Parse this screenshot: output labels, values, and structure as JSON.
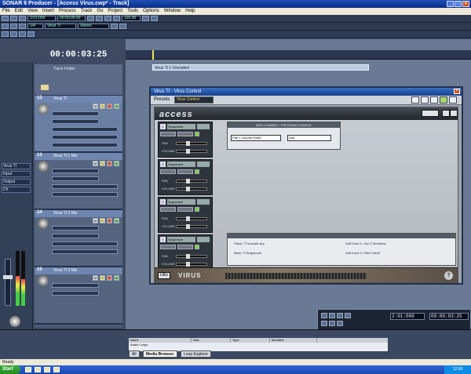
{
  "window": {
    "title": "SONAR 6 Producer - [Access Virus.cwp* - Track]",
    "controls": [
      "_",
      "□",
      "×"
    ]
  },
  "menu": [
    "File",
    "Edit",
    "View",
    "Insert",
    "Process",
    "Track",
    "Go",
    "Project",
    "Tools",
    "Options",
    "Window",
    "Help"
  ],
  "toolbar": {
    "time_field": "2:01:000",
    "bar_field": "00:00:00:00",
    "tempo_field": "120.00",
    "snap_field": "1/4",
    "midi_in": "Virus TI",
    "audio_in": "Stereo"
  },
  "transport": {
    "timecode": "00:00:03:25",
    "now_time": "2:01:000",
    "smpte": "00:00:03:25"
  },
  "inspector": {
    "rows": [
      "Virus TI",
      "Input",
      "Output",
      "Ch"
    ]
  },
  "tracks": {
    "folder_name": "Track Folder",
    "items": [
      {
        "num": "12",
        "name": "Virus TI"
      },
      {
        "num": "13",
        "name": "Virus TI 1 Mix"
      },
      {
        "num": "14",
        "name": "Virus TI 2 Mix"
      },
      {
        "num": "15",
        "name": "Virus TI 3 Mix"
      }
    ],
    "btn_m": "M",
    "btn_s": "S",
    "btn_r": "R",
    "btn_w": "W"
  },
  "arrange": {
    "clip_label": "Virus TI 1 (Vocoder)"
  },
  "plugin": {
    "title": "Virus TI - Virus Control",
    "preset_label": "Presets",
    "preset_value": "Virus Control"
  },
  "virus": {
    "logo": "access",
    "brand": "VIRUS",
    "bottom_button": "Utils",
    "help": "?",
    "parts": [
      {
        "num": "1",
        "name": "Sequencer"
      },
      {
        "num": "2",
        "name": "Sequencer"
      },
      {
        "num": "3",
        "name": "Sequencer"
      },
      {
        "num": "4",
        "name": "Sequencer"
      }
    ],
    "part_label_pan": "PAN",
    "part_label_vol": "VOLUME",
    "midi_title": "MIDI CHANNEL / PROGRAM CHANGE",
    "midi_field1": "Part 1 Volume Enabl",
    "midi_field2": "Dial",
    "info_lines": [
      "Patch: TI Vocoder Arp",
      "Bank: TI Sequencer",
      "Soft Knob 1: Osc 2 Semitone",
      "Soft Knob 2: Filter Cutoff"
    ]
  },
  "bottom": {
    "tabs": [
      "All",
      "Media Browser",
      "Loop Explorer"
    ],
    "browser_cols": [
      "Name",
      "Size",
      "Type",
      "Modified"
    ],
    "browser_path": "Audio Loops"
  },
  "status": "Ready",
  "taskbar": {
    "start": "Start",
    "clock": "12:00"
  }
}
